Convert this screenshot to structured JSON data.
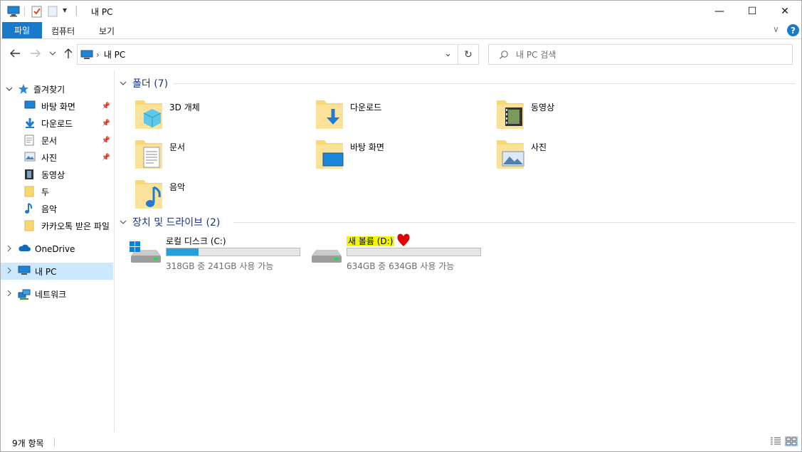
{
  "window": {
    "title": "내 PC",
    "qat_dropdown_glyph": "▾",
    "controls": {
      "minimize": "—",
      "maximize": "☐",
      "close": "✕"
    }
  },
  "ribbon": {
    "tabs": [
      "파일",
      "컴퓨터",
      "보기"
    ],
    "collapse_glyph": "∨",
    "help_glyph": "?"
  },
  "address": {
    "path_separator": "›",
    "path": "내 PC",
    "dropdown_glyph": "⌄",
    "refresh_glyph": "↻",
    "search_placeholder": "내 PC 검색"
  },
  "nav": {
    "quick_access": "즐겨찾기",
    "items": [
      {
        "label": "바탕 화면",
        "icon": "desktop-icon",
        "pinned": true
      },
      {
        "label": "다운로드",
        "icon": "download-icon",
        "pinned": true
      },
      {
        "label": "문서",
        "icon": "document-icon",
        "pinned": true
      },
      {
        "label": "사진",
        "icon": "pictures-icon",
        "pinned": true
      },
      {
        "label": "동영상",
        "icon": "video-icon",
        "pinned": false
      },
      {
        "label": "두",
        "icon": "folder-icon",
        "pinned": false
      },
      {
        "label": "음악",
        "icon": "music-icon",
        "pinned": false
      },
      {
        "label": "카카오톡 받은 파일",
        "icon": "folder-icon",
        "pinned": false
      }
    ],
    "onedrive": "OneDrive",
    "this_pc": "내 PC",
    "network": "네트워크"
  },
  "content": {
    "folders_header": "폴더 (7)",
    "folders": [
      {
        "label": "3D 개체",
        "icon": "3d-objects-icon"
      },
      {
        "label": "다운로드",
        "icon": "download-icon"
      },
      {
        "label": "동영상",
        "icon": "video-icon"
      },
      {
        "label": "문서",
        "icon": "document-icon"
      },
      {
        "label": "바탕 화면",
        "icon": "desktop-icon"
      },
      {
        "label": "사진",
        "icon": "pictures-icon"
      },
      {
        "label": "음악",
        "icon": "music-icon"
      }
    ],
    "drives_header": "장치 및 드라이브 (2)",
    "drives": [
      {
        "label": "로컬 디스크 (C:)",
        "used_fraction": 0.24,
        "space_text": "318GB 중 241GB 사용 가능",
        "highlighted": false
      },
      {
        "label": "새 볼륨 (D:)",
        "used_fraction": 0.0,
        "space_text": "634GB 중 634GB 사용 가능",
        "highlighted": true
      }
    ]
  },
  "status": {
    "item_count": "9개 항목"
  },
  "colors": {
    "accent": "#1979ca",
    "selection": "#cce8ff",
    "header_text": "#1e3287",
    "progress": "#26a0da",
    "highlight": "#f5f500",
    "heart": "#e00000"
  }
}
